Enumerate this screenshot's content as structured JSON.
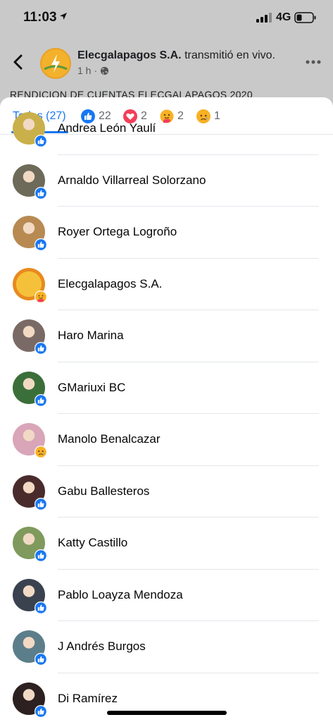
{
  "status_bar": {
    "time": "11:03",
    "network": "4G"
  },
  "post": {
    "page_name": "Elecgalapagos S.A.",
    "action": "transmitió en vivo.",
    "age": "1 h",
    "separator": "·",
    "text_preview": "RENDICION DE CUENTAS ELECGALAPAGOS 2020"
  },
  "tabs": [
    {
      "label": "Todas (27)",
      "icon": null
    },
    {
      "label": "22",
      "icon": "like-icon"
    },
    {
      "label": "2",
      "icon": "love-icon"
    },
    {
      "label": "2",
      "icon": "care-icon"
    },
    {
      "label": "1",
      "icon": "sad-icon"
    }
  ],
  "reactions": [
    {
      "name": "Andrea León Yaulí",
      "reaction": "like-icon",
      "avatar_color": "#c9b04a"
    },
    {
      "name": "Arnaldo Villarreal Solorzano",
      "reaction": "like-icon",
      "avatar_color": "#6d6a5a"
    },
    {
      "name": "Royer Ortega Logroño",
      "reaction": "like-icon",
      "avatar_color": "#b88a52"
    },
    {
      "name": "Elecgalapagos S.A.",
      "reaction": "care-icon",
      "avatar_color": "#f2a81d"
    },
    {
      "name": "Haro Marina",
      "reaction": "like-icon",
      "avatar_color": "#7a6a66"
    },
    {
      "name": "GMariuxi BC",
      "reaction": "like-icon",
      "avatar_color": "#3b6f3a"
    },
    {
      "name": "Manolo Benalcazar",
      "reaction": "sad-icon",
      "avatar_color": "#d9a5b8"
    },
    {
      "name": "Gabu Ballesteros",
      "reaction": "like-icon",
      "avatar_color": "#4a2b2b"
    },
    {
      "name": "Katty Castillo",
      "reaction": "like-icon",
      "avatar_color": "#7f9a5c"
    },
    {
      "name": "Pablo Loayza Mendoza",
      "reaction": "like-icon",
      "avatar_color": "#3a4250"
    },
    {
      "name": "J Andrés Burgos",
      "reaction": "like-icon",
      "avatar_color": "#5c7e8a"
    },
    {
      "name": "Di Ramírez",
      "reaction": "like-icon",
      "avatar_color": "#2c2020"
    }
  ],
  "colors": {
    "accent": "#1877f2",
    "like": "#1877f2",
    "love": "#f33e58",
    "emoji": "#f7b125"
  }
}
